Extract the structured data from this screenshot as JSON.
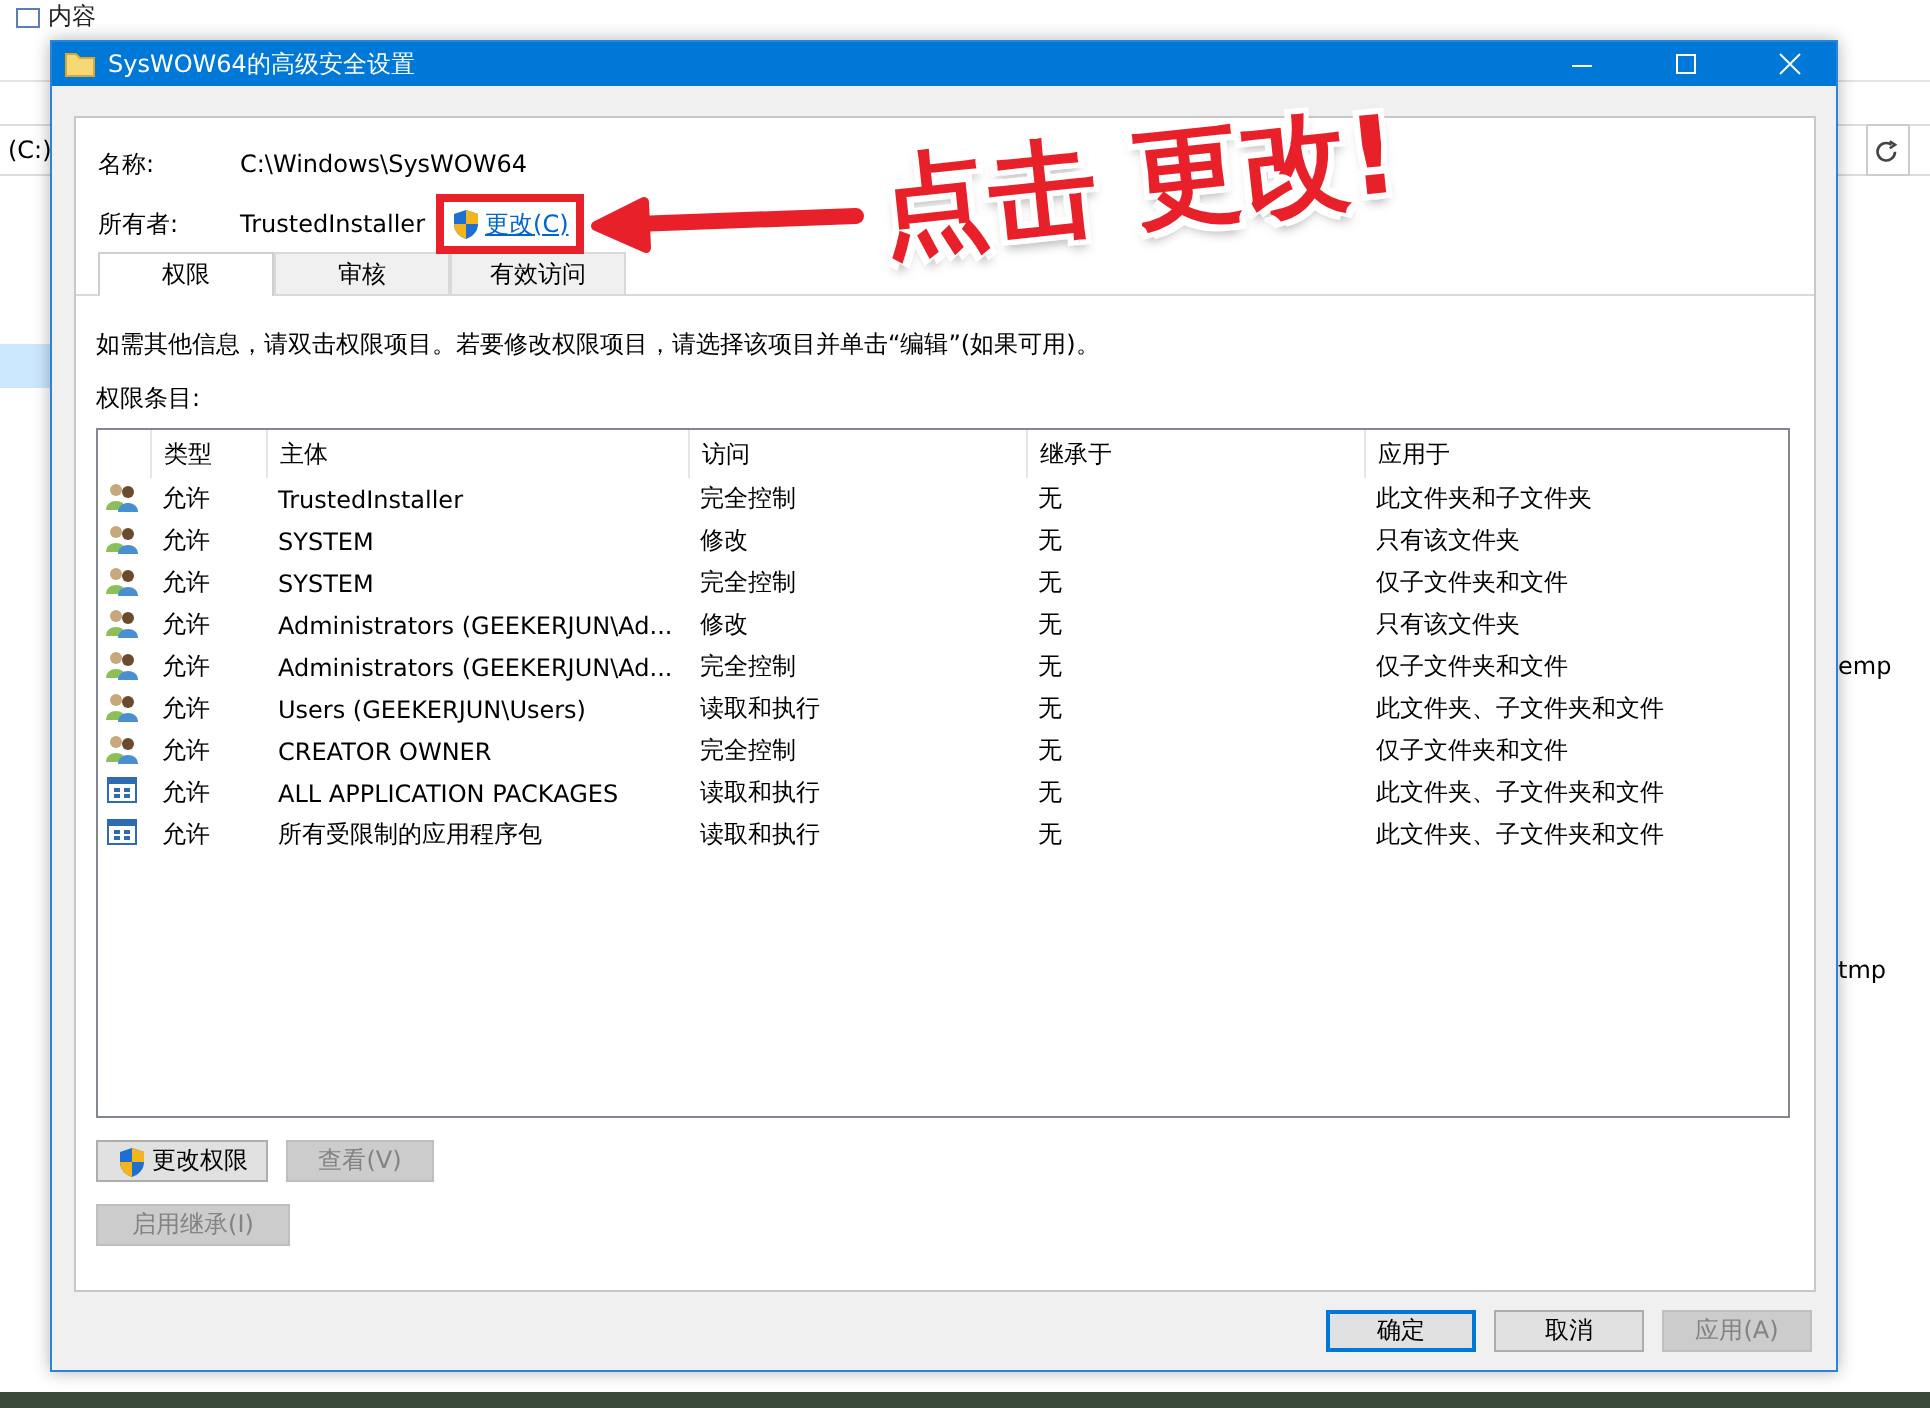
{
  "background": {
    "ribbon_label": "内容",
    "drive_label": "(C:)",
    "side_items": [
      "emp",
      "tmp"
    ]
  },
  "dialog": {
    "title": "SysWOW64的高级安全设置",
    "name_label": "名称:",
    "name_value": "C:\\Windows\\SysWOW64",
    "owner_label": "所有者:",
    "owner_value": "TrustedInstaller",
    "change_link": "更改(C)",
    "tabs": [
      {
        "label": "权限",
        "selected": true
      },
      {
        "label": "审核",
        "selected": false
      },
      {
        "label": "有效访问",
        "selected": false
      }
    ],
    "info_text": "如需其他信息，请双击权限项目。若要修改权限项目，请选择该项目并单击“编辑”(如果可用)。",
    "entries_label": "权限条目:",
    "table": {
      "columns": [
        "类型",
        "主体",
        "访问",
        "继承于",
        "应用于"
      ],
      "rows": [
        {
          "kind": "user",
          "type": "允许",
          "principal": "TrustedInstaller",
          "access": "完全控制",
          "inherited_from": "无",
          "applies_to": "此文件夹和子文件夹"
        },
        {
          "kind": "user",
          "type": "允许",
          "principal": "SYSTEM",
          "access": "修改",
          "inherited_from": "无",
          "applies_to": "只有该文件夹"
        },
        {
          "kind": "user",
          "type": "允许",
          "principal": "SYSTEM",
          "access": "完全控制",
          "inherited_from": "无",
          "applies_to": "仅子文件夹和文件"
        },
        {
          "kind": "user",
          "type": "允许",
          "principal": "Administrators (GEEKERJUN\\Ad...",
          "access": "修改",
          "inherited_from": "无",
          "applies_to": "只有该文件夹"
        },
        {
          "kind": "user",
          "type": "允许",
          "principal": "Administrators (GEEKERJUN\\Ad...",
          "access": "完全控制",
          "inherited_from": "无",
          "applies_to": "仅子文件夹和文件"
        },
        {
          "kind": "user",
          "type": "允许",
          "principal": "Users (GEEKERJUN\\Users)",
          "access": "读取和执行",
          "inherited_from": "无",
          "applies_to": "此文件夹、子文件夹和文件"
        },
        {
          "kind": "user",
          "type": "允许",
          "principal": "CREATOR OWNER",
          "access": "完全控制",
          "inherited_from": "无",
          "applies_to": "仅子文件夹和文件"
        },
        {
          "kind": "package",
          "type": "允许",
          "principal": "ALL APPLICATION PACKAGES",
          "access": "读取和执行",
          "inherited_from": "无",
          "applies_to": "此文件夹、子文件夹和文件"
        },
        {
          "kind": "package",
          "type": "允许",
          "principal": "所有受限制的应用程序包",
          "access": "读取和执行",
          "inherited_from": "无",
          "applies_to": "此文件夹、子文件夹和文件"
        }
      ]
    },
    "buttons": [
      {
        "label": "更改权限",
        "kind": "shield",
        "disabled": false
      },
      {
        "label": "查看(V)",
        "kind": "plain",
        "disabled": true
      }
    ],
    "inherit_button": {
      "label": "启用继承(I)",
      "disabled": true
    },
    "footer_buttons": [
      {
        "label": "确定",
        "default": true,
        "disabled": false
      },
      {
        "label": "取消",
        "default": false,
        "disabled": false
      },
      {
        "label": "应用(A)",
        "default": false,
        "disabled": true
      }
    ]
  },
  "annotation": {
    "text": "点击 更改!"
  }
}
